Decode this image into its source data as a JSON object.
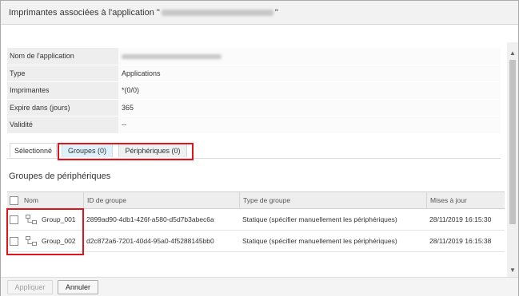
{
  "dialog": {
    "title_prefix": "Imprimantes associées à l'application \"",
    "title_suffix": "\""
  },
  "info": [
    {
      "label": "Nom de l'application",
      "value": ""
    },
    {
      "label": "Type",
      "value": "Applications"
    },
    {
      "label": "Imprimantes",
      "value": "*(0/0)"
    },
    {
      "label": "Expire dans (jours)",
      "value": "365"
    },
    {
      "label": "Validité",
      "value": "--"
    }
  ],
  "tabs": [
    {
      "label": "Sélectionné"
    },
    {
      "label": "Groupes (0)"
    },
    {
      "label": "Périphériques (0)"
    }
  ],
  "section": {
    "title": "Groupes de périphériques"
  },
  "grid": {
    "columns": [
      "Nom",
      "ID de groupe",
      "Type de groupe",
      "Mises à jour"
    ],
    "rows": [
      {
        "name": "Group_001",
        "id": "2899ad90-4db1-426f-a580-d5d7b3abec6a",
        "type": "Statique (spécifier manuellement les périphériques)",
        "updated": "28/11/2019 16:15:30"
      },
      {
        "name": "Group_002",
        "id": "d2c872a6-7201-40d4-95a0-4f5288145bb0",
        "type": "Statique (spécifier manuellement les périphériques)",
        "updated": "28/11/2019 16:15:38"
      }
    ]
  },
  "footer": {
    "apply": "Appliquer",
    "cancel": "Annuler"
  },
  "icons": {
    "scroll_up": "triangle-up",
    "scroll_down": "triangle-down",
    "group": "group-icon"
  },
  "colors": {
    "highlight_box": "#e0141a",
    "active_tab": "#dff2fb"
  }
}
